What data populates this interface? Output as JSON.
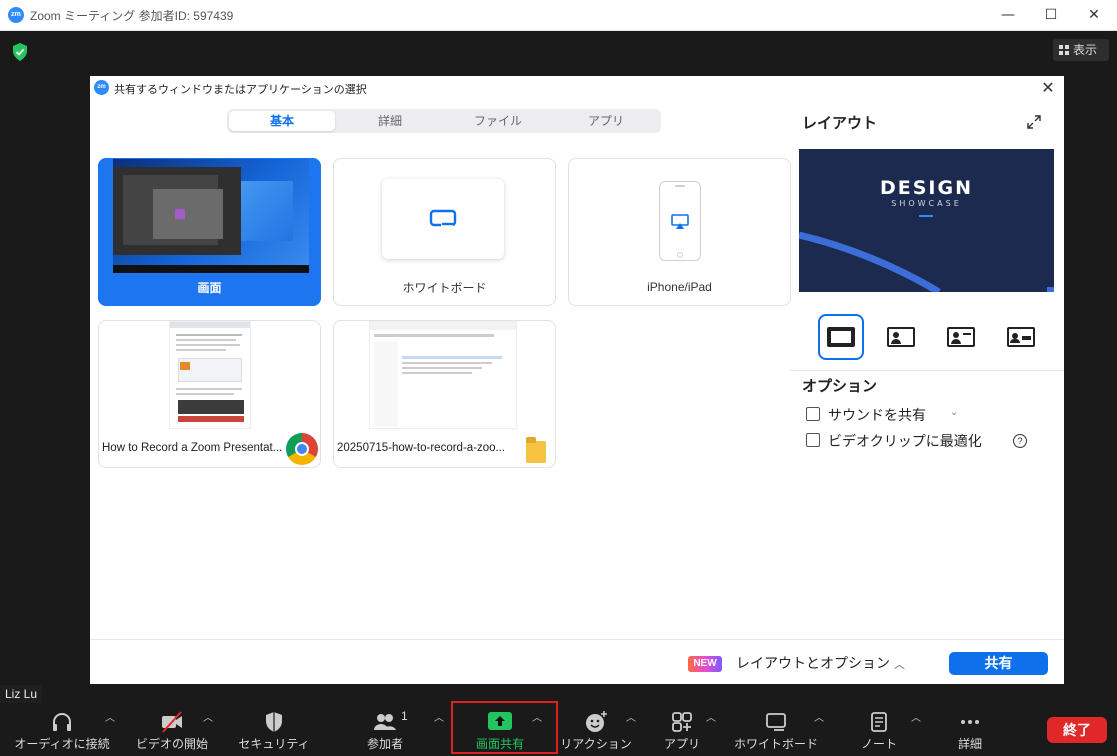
{
  "window": {
    "logo": "zm",
    "title": "Zoom ミーティング 参加者ID: 597439",
    "minimize_icon": "minimize-icon",
    "maximize_icon": "maximize-icon",
    "close_icon": "close-icon"
  },
  "meeting": {
    "view_label": "表示",
    "participant_name": "Liz Lu"
  },
  "dialog": {
    "title": "共有するウィンドウまたはアプリケーションの選択",
    "tabs": [
      {
        "label": "基本",
        "active": true
      },
      {
        "label": "詳細",
        "active": false
      },
      {
        "label": "ファイル",
        "active": false
      },
      {
        "label": "アプリ",
        "active": false
      }
    ],
    "cards": {
      "screen": {
        "label": "画面",
        "selected": true
      },
      "whiteboard": {
        "label": "ホワイトボード"
      },
      "iphone": {
        "label": "iPhone/iPad"
      },
      "chrome_window": {
        "label": "How to Record a Zoom Presentat...",
        "app_icon": "chrome-icon"
      },
      "folder_window": {
        "label": "20250715-how-to-record-a-zoo...",
        "app_icon": "folder-icon"
      }
    },
    "screen_thumb_badge": "L",
    "layout_panel": {
      "title": "レイアウト",
      "preview_title": "DESIGN",
      "preview_subtitle": "SHOWCASE",
      "layout_options": [
        "content-only-icon",
        "content-with-left-camera-icon",
        "content-with-camera-icon",
        "camera-only-icon"
      ]
    },
    "options": {
      "title": "オプション",
      "items": [
        {
          "label": "サウンドを共有",
          "checked": false,
          "has_dropdown": true
        },
        {
          "label": "ビデオクリップに最適化",
          "checked": false,
          "has_help": true
        }
      ]
    },
    "footer": {
      "new_badge": "NEW",
      "layout_options_link": "レイアウトとオプション",
      "share_button": "共有"
    }
  },
  "toolbar": {
    "items": [
      {
        "label": "オーディオに接続",
        "icon": "headphones-icon"
      },
      {
        "label": "ビデオの開始",
        "icon": "video-off-icon"
      },
      {
        "label": "セキュリティ",
        "icon": "shield-icon"
      },
      {
        "label": "参加者",
        "icon": "participants-icon",
        "count": "1"
      },
      {
        "label": "画面共有",
        "icon": "share-screen-icon",
        "active": true
      },
      {
        "label": "リアクション",
        "icon": "reaction-icon"
      },
      {
        "label": "アプリ",
        "icon": "apps-icon"
      },
      {
        "label": "ホワイトボード",
        "icon": "whiteboard-icon"
      },
      {
        "label": "ノート",
        "icon": "notes-icon"
      },
      {
        "label": "詳細",
        "icon": "more-icon"
      }
    ],
    "end_button": "終了",
    "colors": {
      "share_active": "#22c55e",
      "highlight": "#e02020",
      "end": "#e02828",
      "accent": "#0e71eb"
    }
  }
}
